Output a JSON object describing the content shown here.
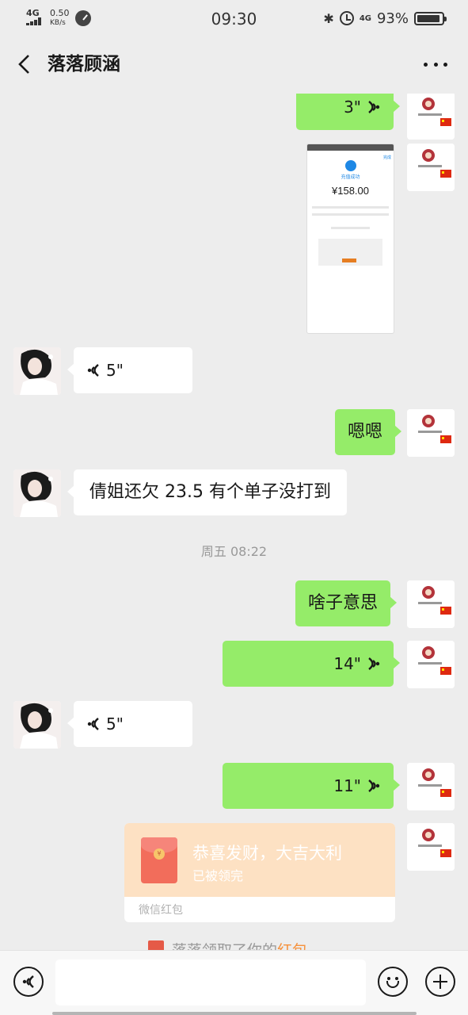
{
  "status_bar": {
    "network_type": "4G",
    "speed_value": "0.50",
    "speed_unit": "KB/s",
    "time": "09:30",
    "mobile_data": "4G",
    "battery_percent": "93%",
    "battery_level": 0.93
  },
  "header": {
    "title": "落落顾涵"
  },
  "messages": {
    "m1": {
      "sender": "me",
      "type": "voice",
      "duration": "3\""
    },
    "m2": {
      "sender": "me",
      "type": "image",
      "image_sub": "充值成功",
      "image_amount": "¥158.00",
      "image_tag": "完成"
    },
    "m3": {
      "sender": "them",
      "type": "voice",
      "duration": "5\""
    },
    "m4": {
      "sender": "me",
      "type": "text",
      "text": "嗯嗯"
    },
    "m5": {
      "sender": "them",
      "type": "text",
      "text": "倩姐还欠 23.5 有个单子没打到"
    },
    "timestamp": "周五 08:22",
    "m6": {
      "sender": "me",
      "type": "text",
      "text": "啥子意思"
    },
    "m7": {
      "sender": "me",
      "type": "voice",
      "duration": "14\""
    },
    "m8": {
      "sender": "them",
      "type": "voice",
      "duration": "5\""
    },
    "m9": {
      "sender": "me",
      "type": "voice",
      "duration": "11\""
    },
    "m10": {
      "sender": "me",
      "type": "red_packet",
      "title": "恭喜发财，大吉大利",
      "status": "已被领完",
      "footer": "微信红包"
    }
  },
  "system_note": {
    "prefix": "落落领取了你的",
    "highlight": "红包"
  },
  "input_bar": {
    "placeholder": ""
  }
}
